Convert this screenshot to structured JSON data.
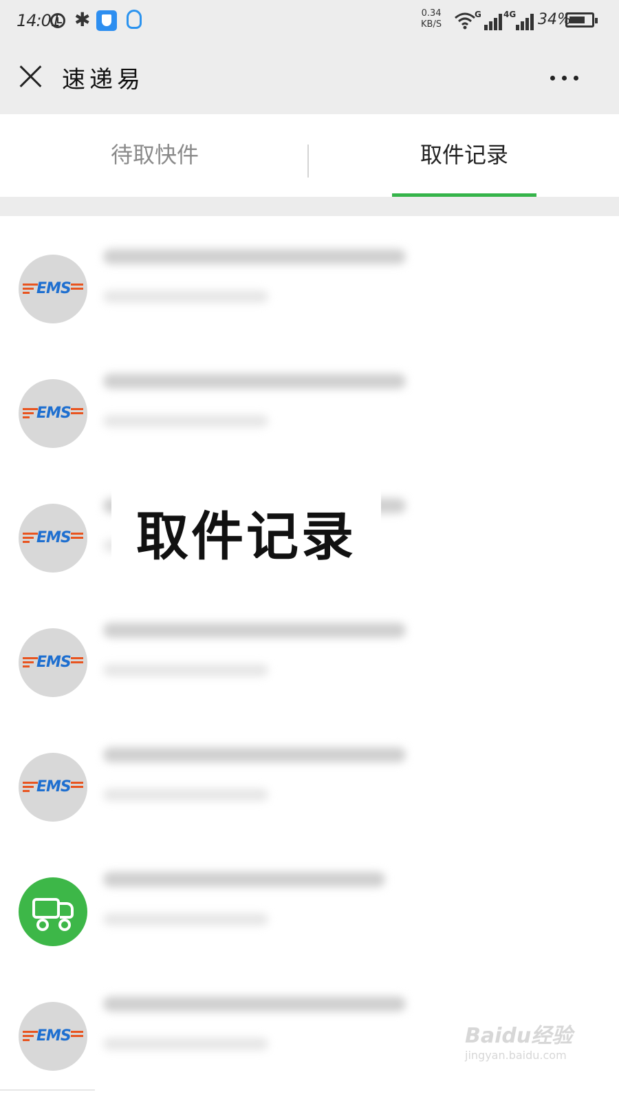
{
  "status_bar": {
    "time": "14:01",
    "net_speed_value": "0.34",
    "net_speed_unit": "KB/S",
    "signal_1_label": "G",
    "signal_2_label": "4G",
    "battery_text": "34%",
    "battery_level": 0.34,
    "icons": [
      "alarm-icon",
      "bluetooth-icon",
      "shield-icon",
      "qq-icon",
      "wifi-icon",
      "signal-icon",
      "battery-icon"
    ]
  },
  "nav": {
    "title": "速递易",
    "close_icon": "close-icon",
    "more_icon": "more-icon"
  },
  "tabs": [
    {
      "label": "待取快件",
      "active": false
    },
    {
      "label": "取件记录",
      "active": true
    }
  ],
  "accent_color": "#35b44a",
  "records": [
    {
      "carrier": "EMS",
      "icon": "ems-logo"
    },
    {
      "carrier": "EMS",
      "icon": "ems-logo"
    },
    {
      "carrier": "EMS",
      "icon": "ems-logo"
    },
    {
      "carrier": "EMS",
      "icon": "ems-logo"
    },
    {
      "carrier": "EMS",
      "icon": "ems-logo"
    },
    {
      "carrier": "",
      "icon": "truck-icon"
    },
    {
      "carrier": "EMS",
      "icon": "ems-logo"
    }
  ],
  "overlay": {
    "caption": "取件记录"
  },
  "watermark": {
    "logo": "Baidu经验",
    "url": "jingyan.baidu.com"
  }
}
